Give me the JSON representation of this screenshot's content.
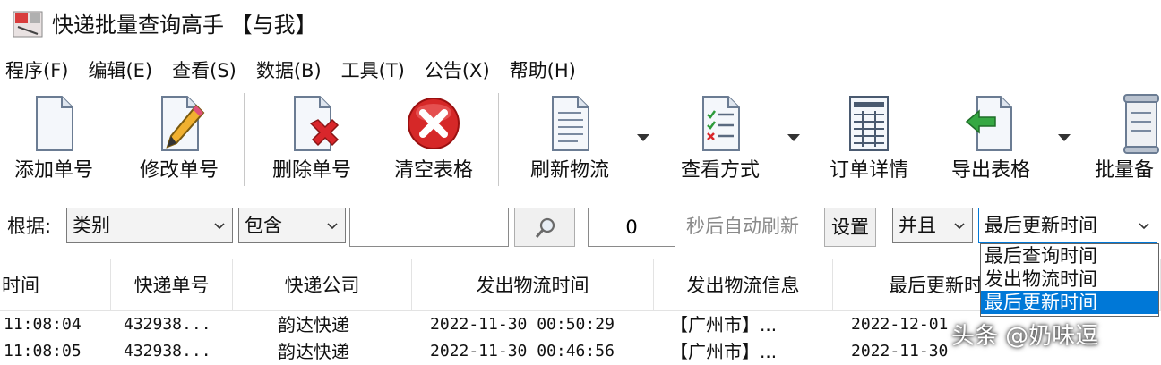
{
  "window": {
    "title": "快递批量查询高手 【与我】"
  },
  "menu": [
    {
      "label": "程序(F)"
    },
    {
      "label": "编辑(E)"
    },
    {
      "label": "查看(S)"
    },
    {
      "label": "数据(B)"
    },
    {
      "label": "工具(T)"
    },
    {
      "label": "公告(X)"
    },
    {
      "label": "帮助(H)"
    }
  ],
  "toolbar": {
    "add": "添加单号",
    "edit": "修改单号",
    "delete": "删除单号",
    "clear": "清空表格",
    "refresh": "刷新物流",
    "view_mode": "查看方式",
    "order_detail": "订单详情",
    "export": "导出表格",
    "batch": "批量备"
  },
  "filter": {
    "label": "根据:",
    "field_value": "类别",
    "operator_value": "包含",
    "keyword_value": "",
    "refresh_seconds": "0",
    "auto_refresh_text": "秒后自动刷新",
    "settings_label": "设置",
    "logic_value": "并且",
    "sort_value": "最后更新时间",
    "sort_options": [
      {
        "label": "最后查询时间"
      },
      {
        "label": "发出物流时间"
      },
      {
        "label": "最后更新时间"
      }
    ]
  },
  "table": {
    "headers": [
      "时间",
      "快递单号",
      "快递公司",
      "发出物流时间",
      "发出物流信息",
      "最后更新时"
    ],
    "rows": [
      {
        "time": "11:08:04",
        "number": "432938...",
        "company": "韵达快递",
        "sent_time": "2022-11-30 00:50:29",
        "sent_info": "【广州市】...",
        "last_update": "2022-12-01 "
      },
      {
        "time": "11:08:05",
        "number": "432938...",
        "company": "韵达快递",
        "sent_time": "2022-11-30 00:46:56",
        "sent_info": "【广州市】...",
        "last_update": "2022-11-30 "
      }
    ]
  },
  "watermark": "头条 @奶味逗",
  "icons": {
    "app": "app-icon",
    "add": "document-icon",
    "edit": "document-pencil-icon",
    "delete": "document-x-icon",
    "clear": "red-x-circle-icon",
    "refresh": "document-lines-icon",
    "view": "checklist-icon",
    "detail": "grid-document-icon",
    "export": "export-arrow-icon",
    "batch": "scroll-icon",
    "search": "magnifier-icon",
    "chevron": "chevron-down-icon"
  }
}
